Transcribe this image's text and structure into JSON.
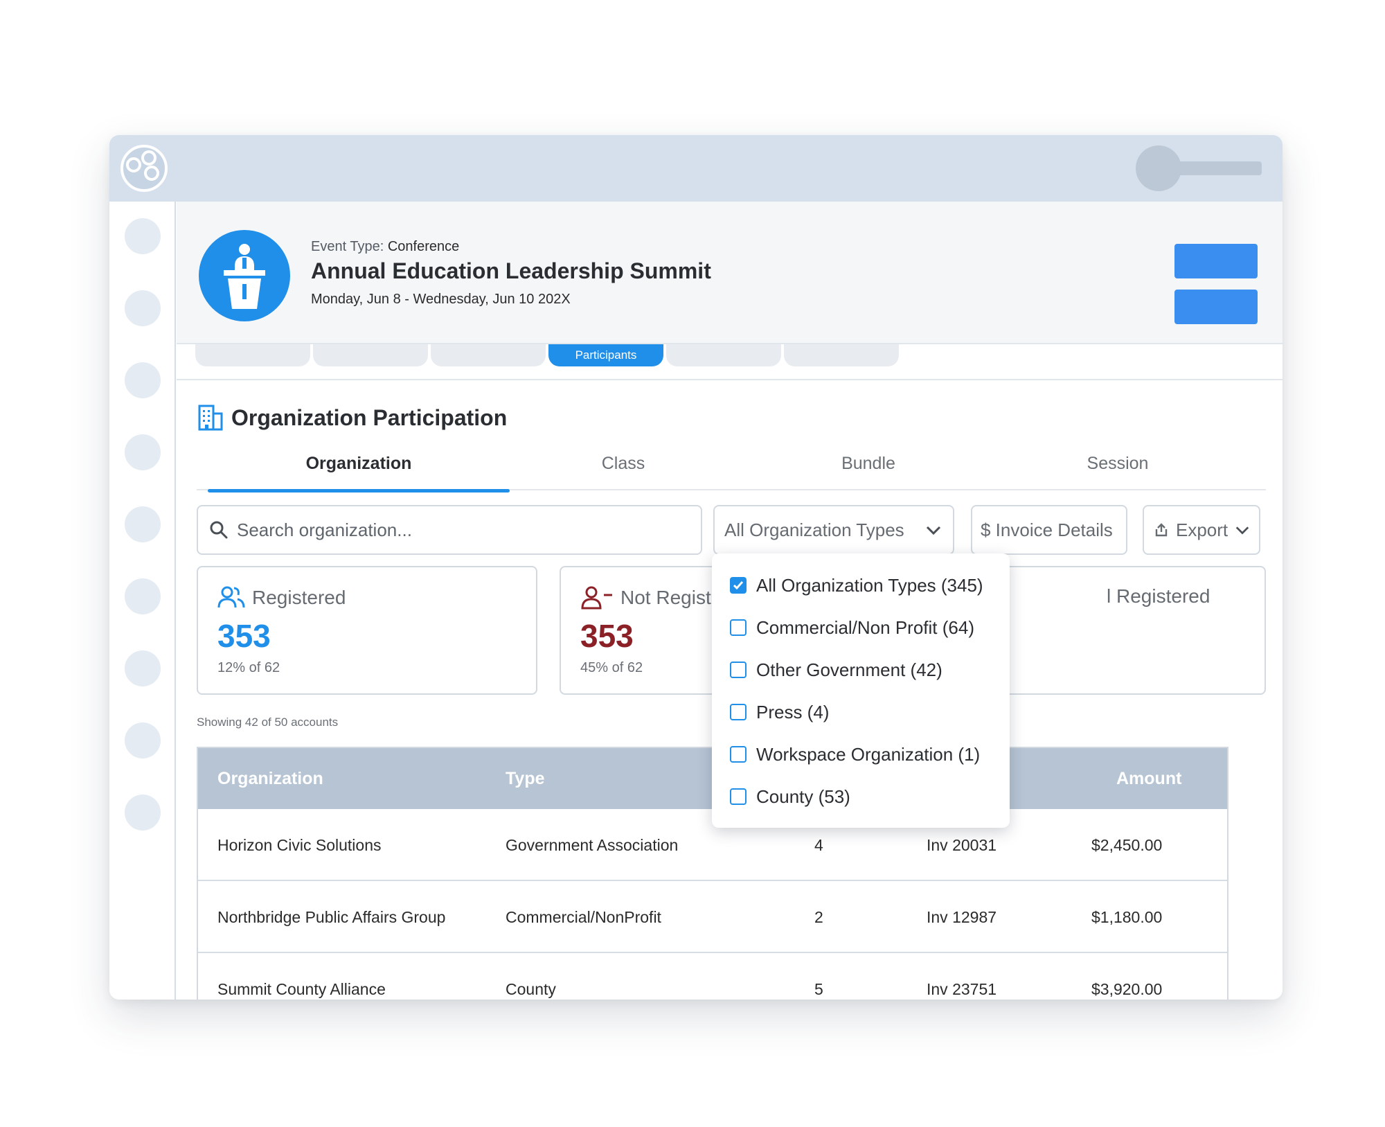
{
  "header": {
    "event_type_label": "Event Type:",
    "event_type_value": "Conference",
    "title": "Annual Education Leadership Summit",
    "dates": "Monday, Jun 8 - Wednesday, Jun 10 202X"
  },
  "tabs": {
    "active_label": "Participants"
  },
  "section": {
    "title": "Organization Participation"
  },
  "subtabs": [
    {
      "label": "Organization",
      "active": true
    },
    {
      "label": "Class",
      "active": false
    },
    {
      "label": "Bundle",
      "active": false
    },
    {
      "label": "Session",
      "active": false
    }
  ],
  "toolbar": {
    "search_placeholder": "Search organization...",
    "type_filter_label": "All Organization Types",
    "invoice_label": "$ Invoice Details",
    "export_label": "Export"
  },
  "stats": {
    "registered": {
      "label": "Registered",
      "value": "353",
      "sub": "12% of 62",
      "color": "#1f8fea"
    },
    "not_registered": {
      "label": "Not Regist",
      "value": "353",
      "sub": "45% of 62",
      "color": "#8b2126"
    },
    "third": {
      "label": "l Registered"
    }
  },
  "showing_text": "Showing 42 of 50 accounts",
  "table": {
    "headers": {
      "organization": "Organization",
      "type": "Type",
      "amount": "Amount"
    },
    "rows": [
      {
        "organization": "Horizon Civic Solutions",
        "type": "Government Association",
        "count": "4",
        "invoice": "Inv 20031",
        "amount": "$2,450.00"
      },
      {
        "organization": "Northbridge Public Affairs Group",
        "type": "Commercial/NonProfit",
        "count": "2",
        "invoice": "Inv 12987",
        "amount": "$1,180.00"
      },
      {
        "organization": "Summit County Alliance",
        "type": "County",
        "count": "5",
        "invoice": "Inv 23751",
        "amount": "$3,920.00"
      }
    ]
  },
  "dropdown": {
    "options": [
      {
        "label": "All Organization Types (345)",
        "checked": true
      },
      {
        "label": "Commercial/Non Profit (64)",
        "checked": false
      },
      {
        "label": "Other Government (42)",
        "checked": false
      },
      {
        "label": "Press (4)",
        "checked": false
      },
      {
        "label": "Workspace Organization (1)",
        "checked": false
      },
      {
        "label": "County (53)",
        "checked": false
      }
    ]
  },
  "colors": {
    "accent": "#1f8fea",
    "header_bar": "#d5e0ec",
    "table_header": "#b6c4d4",
    "danger": "#8b2126"
  },
  "icons": {
    "logo": "app-logo-icon",
    "event": "podium-speaker-icon",
    "section": "building-icon",
    "search": "search-icon",
    "dropdown": "chevron-down-icon",
    "export": "export-icon",
    "registered": "users-icon",
    "not_registered": "user-minus-icon",
    "checkbox": "checkbox-icon"
  }
}
